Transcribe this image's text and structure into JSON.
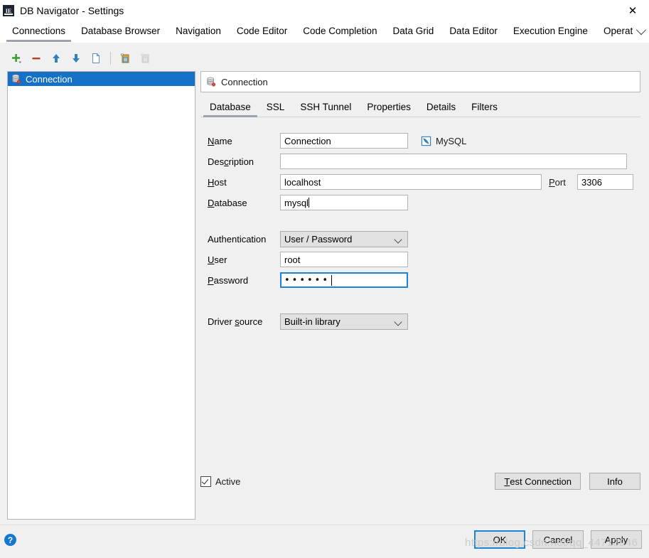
{
  "window": {
    "title": "DB Navigator - Settings",
    "app_icon": "ide-icon",
    "close_label": "✕"
  },
  "top_tabs": {
    "items": [
      {
        "label": "Connections",
        "active": true
      },
      {
        "label": "Database Browser",
        "active": false
      },
      {
        "label": "Navigation",
        "active": false
      },
      {
        "label": "Code Editor",
        "active": false
      },
      {
        "label": "Code Completion",
        "active": false
      },
      {
        "label": "Data Grid",
        "active": false
      },
      {
        "label": "Data Editor",
        "active": false
      },
      {
        "label": "Execution Engine",
        "active": false
      },
      {
        "label": "Operati",
        "active": false
      }
    ],
    "overflow_icon": "chevron-down-icon"
  },
  "toolbar": {
    "buttons": [
      {
        "name": "add-connection-button",
        "icon": "plus-icon",
        "tooltip": "Add"
      },
      {
        "name": "remove-connection-button",
        "icon": "minus-icon",
        "tooltip": "Remove"
      },
      {
        "name": "move-up-button",
        "icon": "arrow-up-icon",
        "tooltip": "Move Up"
      },
      {
        "name": "move-down-button",
        "icon": "arrow-down-icon",
        "tooltip": "Move Down"
      },
      {
        "name": "duplicate-button",
        "icon": "copy-icon",
        "tooltip": "Duplicate"
      },
      {
        "name": "copy-connection-button",
        "icon": "copy-database-icon",
        "tooltip": "Copy"
      },
      {
        "name": "paste-connection-button",
        "icon": "paste-database-icon",
        "tooltip": "Paste"
      }
    ]
  },
  "connection_list": {
    "items": [
      {
        "label": "Connection",
        "icon": "database-icon",
        "selected": true
      }
    ]
  },
  "detail": {
    "header": {
      "title": "Connection",
      "icon": "database-icon"
    },
    "tabs": [
      {
        "label": "Database",
        "active": true
      },
      {
        "label": "SSL",
        "active": false
      },
      {
        "label": "SSH Tunnel",
        "active": false
      },
      {
        "label": "Properties",
        "active": false
      },
      {
        "label": "Details",
        "active": false
      },
      {
        "label": "Filters",
        "active": false
      }
    ],
    "fields": {
      "name": {
        "label": "Name",
        "mnemonic": "N",
        "value": "Connection"
      },
      "dbtype": {
        "label": "MySQL",
        "icon": "mysql-icon"
      },
      "description": {
        "label": "Description",
        "mnemonic": "c",
        "value": "",
        "placeholder": ""
      },
      "host": {
        "label": "Host",
        "mnemonic": "H",
        "value": "localhost"
      },
      "port": {
        "label": "Port",
        "mnemonic": "P",
        "value": "3306"
      },
      "database": {
        "label": "Database",
        "mnemonic": "D",
        "value": "mysql",
        "has_caret": true
      },
      "authentication": {
        "label": "Authentication",
        "value": "User / Password",
        "options": [
          "User / Password"
        ]
      },
      "user": {
        "label": "User",
        "mnemonic": "U",
        "value": "root"
      },
      "password": {
        "label": "Password",
        "mnemonic": "P",
        "value": "••••••",
        "focused": true
      },
      "driver_source": {
        "label": "Driver source",
        "mnemonic": "s",
        "value": "Built-in library",
        "options": [
          "Built-in library"
        ]
      }
    },
    "active_checkbox": {
      "label": "Active",
      "checked": true
    },
    "buttons": {
      "test_connection": "Test Connection",
      "test_connection_mnemonic": "T",
      "info": "Info"
    }
  },
  "footer": {
    "help_icon": "help-icon",
    "help_label": "?",
    "buttons": [
      {
        "label": "OK",
        "default": true
      },
      {
        "label": "Cancel",
        "default": false
      },
      {
        "label": "Apply",
        "default": false
      }
    ]
  },
  "watermark": {
    "text": "https://blog.csdn.net/qq_44713946"
  },
  "colors": {
    "selection_blue": "#1571c8",
    "focus_blue": "#1a84d8",
    "tab_underline": "#9aa3ae",
    "dialog_bg": "#f0f0f0"
  }
}
